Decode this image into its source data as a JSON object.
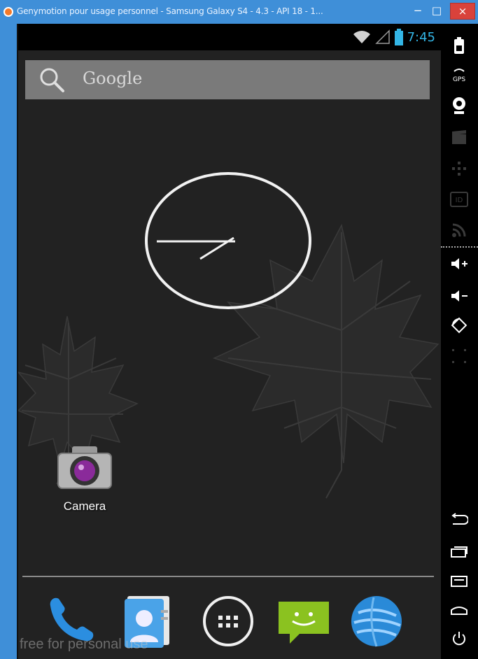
{
  "window": {
    "title": "Genymotion pour usage personnel - Samsung Galaxy S4 - 4.3 - API 18 - 1...",
    "minimize_glyph": "−",
    "maximize_glyph": "□",
    "close_glyph": "×"
  },
  "status_bar": {
    "time": "7:45",
    "icons": [
      "wifi-icon",
      "signal-icon",
      "battery-icon"
    ],
    "accent": "#33b5e5"
  },
  "search": {
    "label": "Google",
    "icon": "search-icon"
  },
  "clock": {
    "type": "analog",
    "icon": "analog-clock-widget"
  },
  "home_apps": [
    {
      "label": "Camera",
      "icon": "camera-icon"
    }
  ],
  "dock": [
    {
      "icon": "phone-icon"
    },
    {
      "icon": "contacts-icon"
    },
    {
      "icon": "app-drawer-icon"
    },
    {
      "icon": "messaging-icon"
    },
    {
      "icon": "browser-icon"
    }
  ],
  "watermark": "free for personal use",
  "sidebar": {
    "items": [
      "battery-icon",
      "gps-icon",
      "camera-webcam-icon",
      "clapperboard-icon",
      "dpad-icon",
      "id-icon",
      "rss-icon",
      "volume-up-icon",
      "volume-down-icon",
      "rotate-icon",
      "resize-icon",
      "back-icon",
      "recent-apps-icon",
      "menu-icon",
      "home-icon",
      "power-icon"
    ],
    "gps_label": "GPS",
    "id_label": "ID"
  }
}
